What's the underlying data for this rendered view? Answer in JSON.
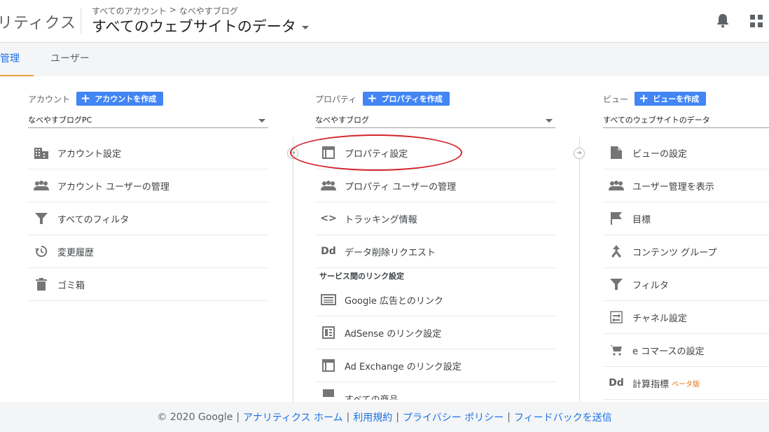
{
  "header": {
    "app_name": "リティクス",
    "breadcrumb": [
      "すべてのアカウント",
      ">",
      "なべやすブログ"
    ],
    "view_title": "すべてのウェブサイトのデータ"
  },
  "tabs": {
    "admin": "管理",
    "user": "ユーザー"
  },
  "account": {
    "label": "アカウント",
    "create": "アカウントを作成",
    "selected": "なべやすブログPC",
    "items": [
      "アカウント設定",
      "アカウント ユーザーの管理",
      "すべてのフィルタ",
      "変更履歴",
      "ゴミ箱"
    ]
  },
  "property": {
    "label": "プロパティ",
    "create": "プロパティを作成",
    "selected": "なべやすブログ",
    "items": [
      "プロパティ設定",
      "プロパティ ユーザーの管理",
      "トラッキング情報",
      "データ削除リクエスト"
    ],
    "section": "サービス間のリンク設定",
    "links": [
      "Google 広告とのリンク",
      "AdSense のリンク設定",
      "Ad Exchange のリンク設定",
      "すべての商品"
    ]
  },
  "view": {
    "label": "ビュー",
    "create": "ビューを作成",
    "selected": "すべてのウェブサイトのデータ",
    "items": [
      "ビューの設定",
      "ユーザー管理を表示",
      "目標",
      "コンテンツ グループ",
      "フィルタ",
      "チャネル設定",
      "e コマースの設定",
      "計算指標"
    ],
    "beta": "ベータ版"
  },
  "icons": {
    "dd": "Dd",
    "code": "<>"
  },
  "footer": {
    "copyright": "© 2020 Google",
    "sep": "|",
    "links": [
      "アナリティクス ホーム",
      "利用規約",
      "プライバシー ポリシー",
      "フィードバックを送信"
    ]
  },
  "colors": {
    "accent": "#4285f4",
    "tab_underline": "#e8a33d",
    "highlight": "#d2232a",
    "link": "#1a73e8"
  }
}
